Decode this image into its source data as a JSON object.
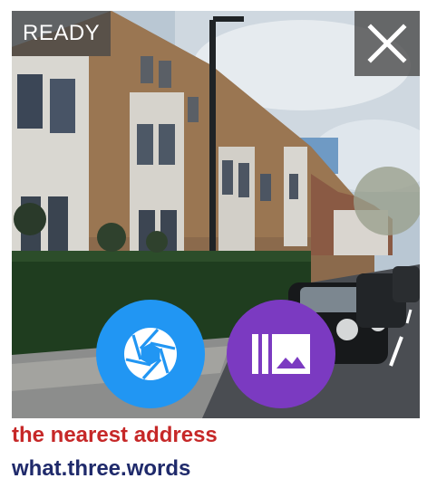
{
  "status": {
    "label": "READY"
  },
  "icons": {
    "close": "close-icon",
    "shutter": "camera-aperture-icon",
    "gallery": "photo-library-icon"
  },
  "colors": {
    "shutter_button": "#2196f3",
    "gallery_button": "#7b3ac1",
    "line1_text": "#c62828",
    "line2_text": "#1f2a6b"
  },
  "text": {
    "line1": "the nearest address",
    "line2": "what.three.words"
  }
}
